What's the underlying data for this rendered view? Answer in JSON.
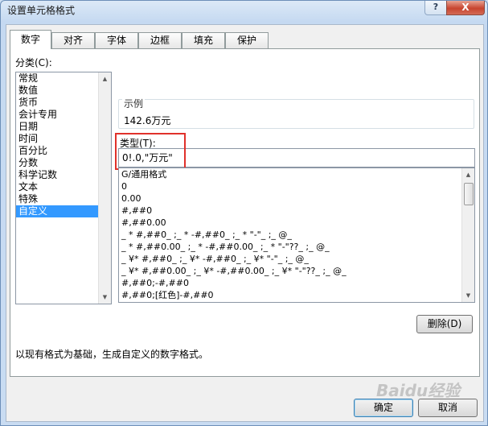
{
  "window": {
    "title": "设置单元格格式",
    "help": "?",
    "close": "X"
  },
  "tabs": [
    {
      "label": "数字"
    },
    {
      "label": "对齐"
    },
    {
      "label": "字体"
    },
    {
      "label": "边框"
    },
    {
      "label": "填充"
    },
    {
      "label": "保护"
    }
  ],
  "category": {
    "label": "分类(C):",
    "items": [
      "常规",
      "数值",
      "货币",
      "会计专用",
      "日期",
      "时间",
      "百分比",
      "分数",
      "科学记数",
      "文本",
      "特殊",
      "自定义"
    ],
    "selected": "自定义"
  },
  "sample": {
    "label": "示例",
    "value": "142.6万元"
  },
  "type": {
    "label": "类型(T):",
    "value": "0!.0,\"万元\"",
    "formats": [
      "G/通用格式",
      "0",
      "0.00",
      "#,##0",
      "#,##0.00",
      "_ * #,##0_ ;_ * -#,##0_ ;_ * \"-\"_ ;_ @_",
      "_ * #,##0.00_ ;_ * -#,##0.00_ ;_ * \"-\"??_ ;_ @_",
      "_ ¥* #,##0_ ;_ ¥* -#,##0_ ;_ ¥* \"-\"_ ;_ @_",
      "_ ¥* #,##0.00_ ;_ ¥* -#,##0.00_ ;_ ¥* \"-\"??_ ;_ @_",
      "#,##0;-#,##0",
      "#,##0;[红色]-#,##0"
    ]
  },
  "delete_button": "删除(D)",
  "description": "以现有格式为基础，生成自定义的数字格式。",
  "ok_button": "确定",
  "cancel_button": "取消",
  "watermark": "Baidu经验"
}
